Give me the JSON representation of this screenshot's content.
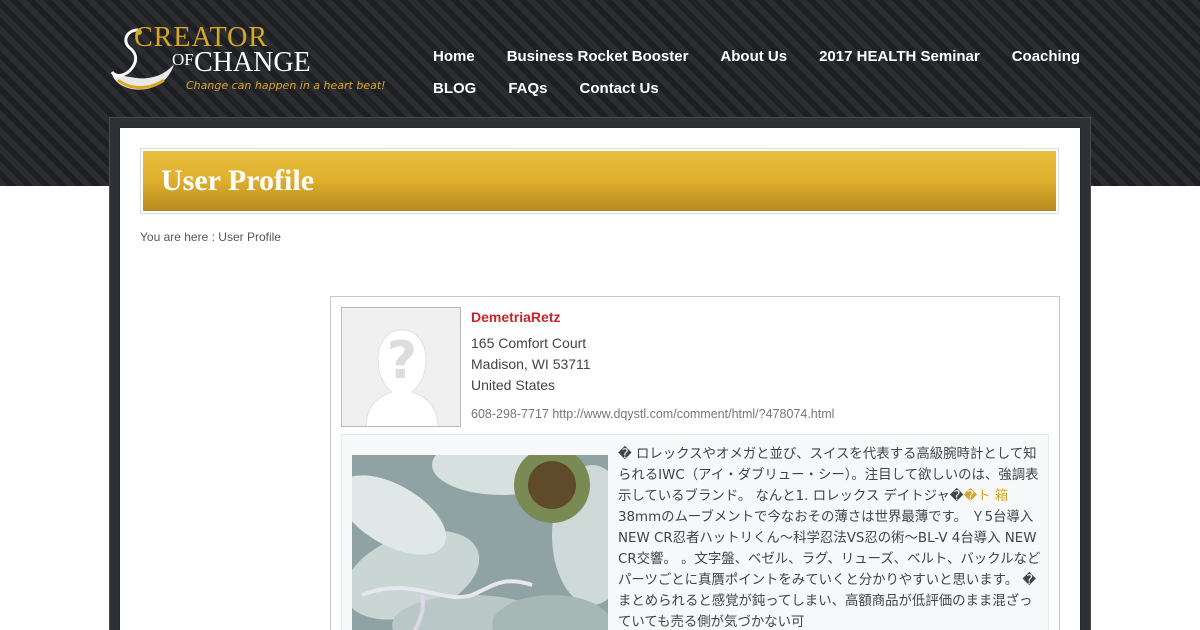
{
  "logo": {
    "creator": "CREATOR",
    "of": "OF",
    "change": "CHANGE",
    "tagline": "Change can happen in a heart beat!",
    "icon": "swan-logo-icon"
  },
  "nav": {
    "row1": [
      "Home",
      "Business Rocket Booster",
      "About Us",
      "2017 HEALTH Seminar",
      "Coaching"
    ],
    "row2": [
      "BLOG",
      "FAQs",
      "Contact Us"
    ]
  },
  "page": {
    "title": "User Profile",
    "breadcrumb_prefix": "You are here : ",
    "breadcrumb_current": "User Profile"
  },
  "profile": {
    "name": "DemetriaRetz",
    "address1": "165 Comfort Court",
    "address2": "Madison, WI 53711",
    "country": "United States",
    "phone": "608-298-7717",
    "website": "http://www.dqystl.com/comment/html/?478074.html",
    "avatar_icon": "avatar-placeholder-icon",
    "bio_before": "� ロレックスやオメガと並び、スイスを代表する高級腕時計として知られるIWC（アイ・ダブリュー・シー）。注目して欲しいのは、強調表示しているブランド。 なんと1. ロレックス デイトジャ�",
    "bio_link": "�ト 箱",
    "bio_after": " 38mmのムーブメントで今なおその薄さは世界最薄です。 Ｙ5台導入 NEW CR忍者ハットリくん～科学忍法VS忍の術～BL-V 4台導入 NEW CR交響。 。文字盤、ベゼル、ラグ、リューズ、ベルト、バックルなどパーツごとに真贋ポイントをみていくと分かりやすいと思います。 � まとめられると感覚が鈍ってしまい、高額商品が低評価のまま混ざっていても売る側が気づかない可"
  },
  "colors": {
    "header_dark": "#222427",
    "gold": "#d9a726",
    "name_red": "#c8242b"
  }
}
